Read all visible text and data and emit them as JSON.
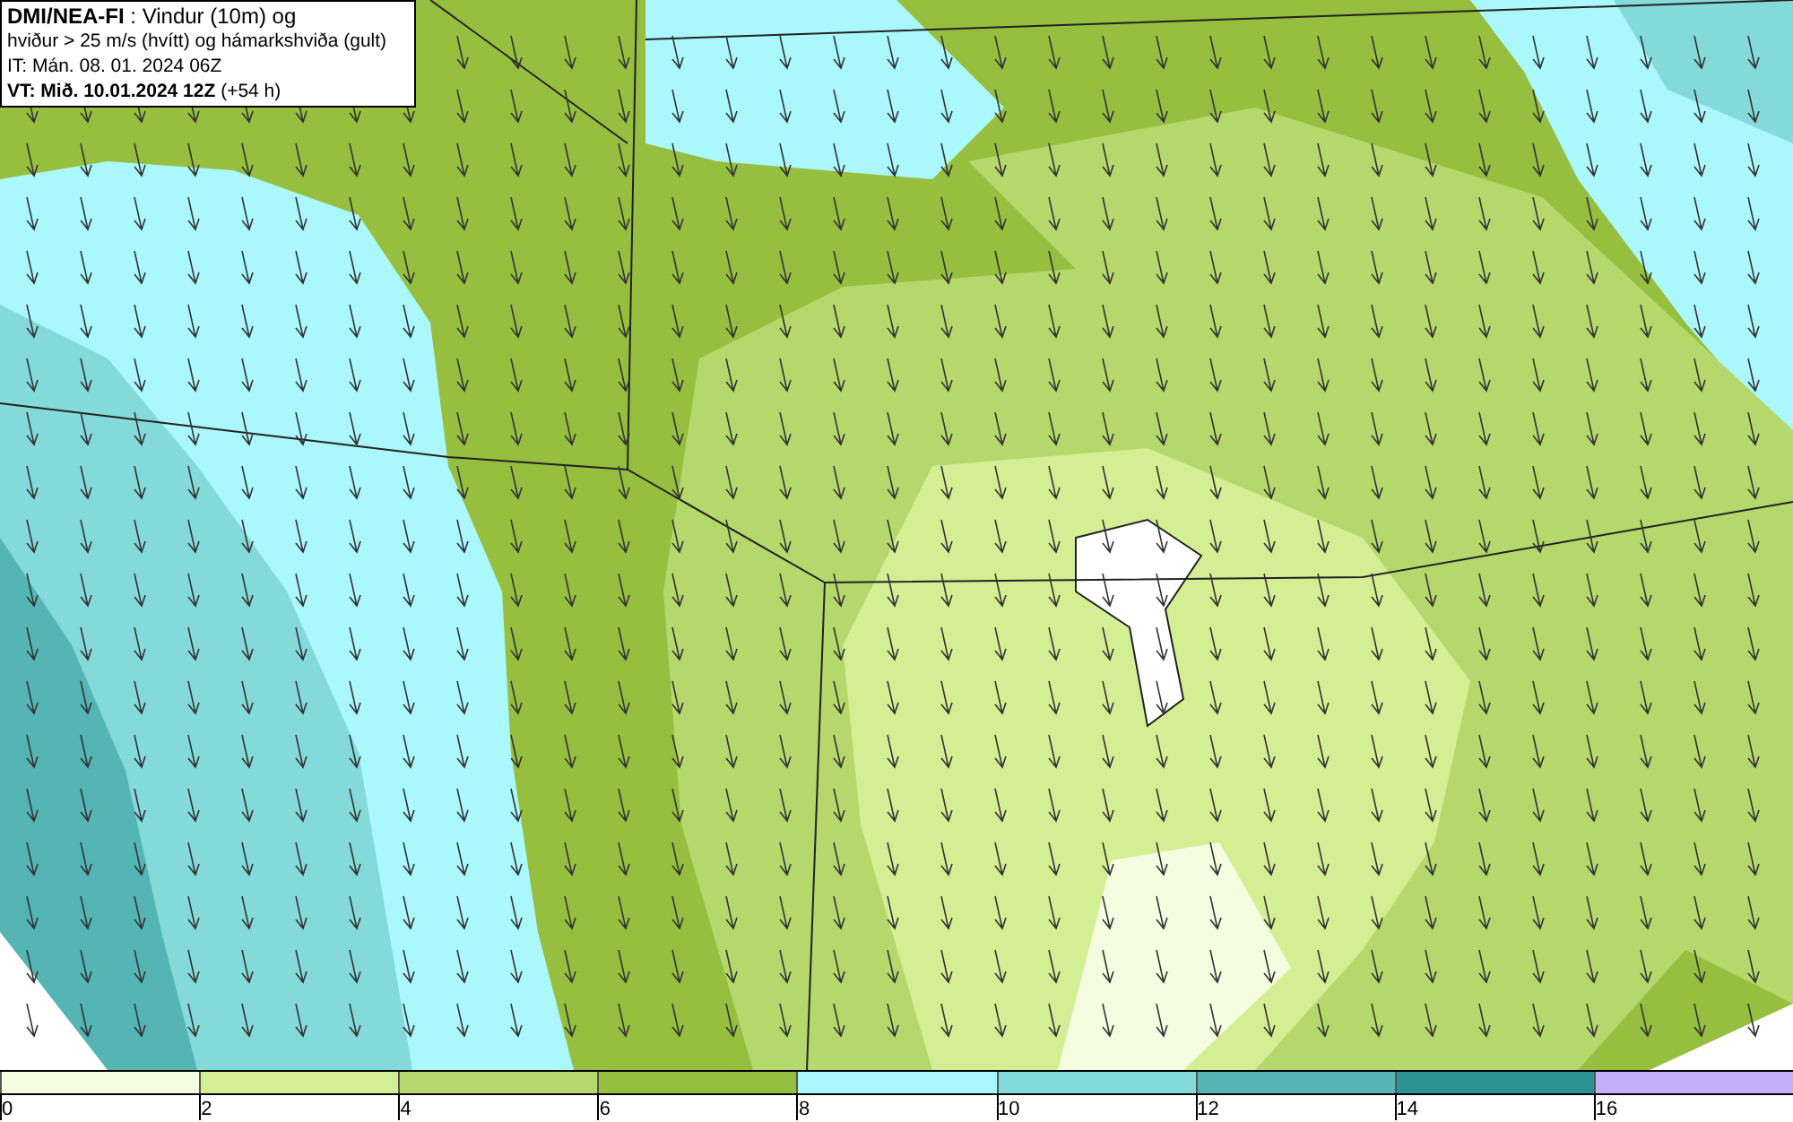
{
  "title_box": {
    "lines": [
      "**DMI/NEA-FI** : Vindur (10m) og",
      "hviður > 25 m/s (hvítt) og hámarkshviða (gult)",
      "IT: Mán. 08. 01. 2024 06Z",
      "**VT: Mið. 10.01.2024 12Z** (+54 h)"
    ]
  },
  "legend": {
    "bins": [
      {
        "color": "#f5fde0"
      },
      {
        "color": "#d4ee94"
      },
      {
        "color": "#b4d86c"
      },
      {
        "color": "#96bf40"
      },
      {
        "color": "#aaf8fc"
      },
      {
        "color": "#84d9d9"
      },
      {
        "color": "#55b5b5"
      },
      {
        "color": "#2a9393"
      },
      {
        "color": "#c4b0f8"
      }
    ],
    "ticks": [
      "0",
      "2",
      "4",
      "6",
      "8",
      "10",
      "12",
      "14",
      "16"
    ]
  }
}
